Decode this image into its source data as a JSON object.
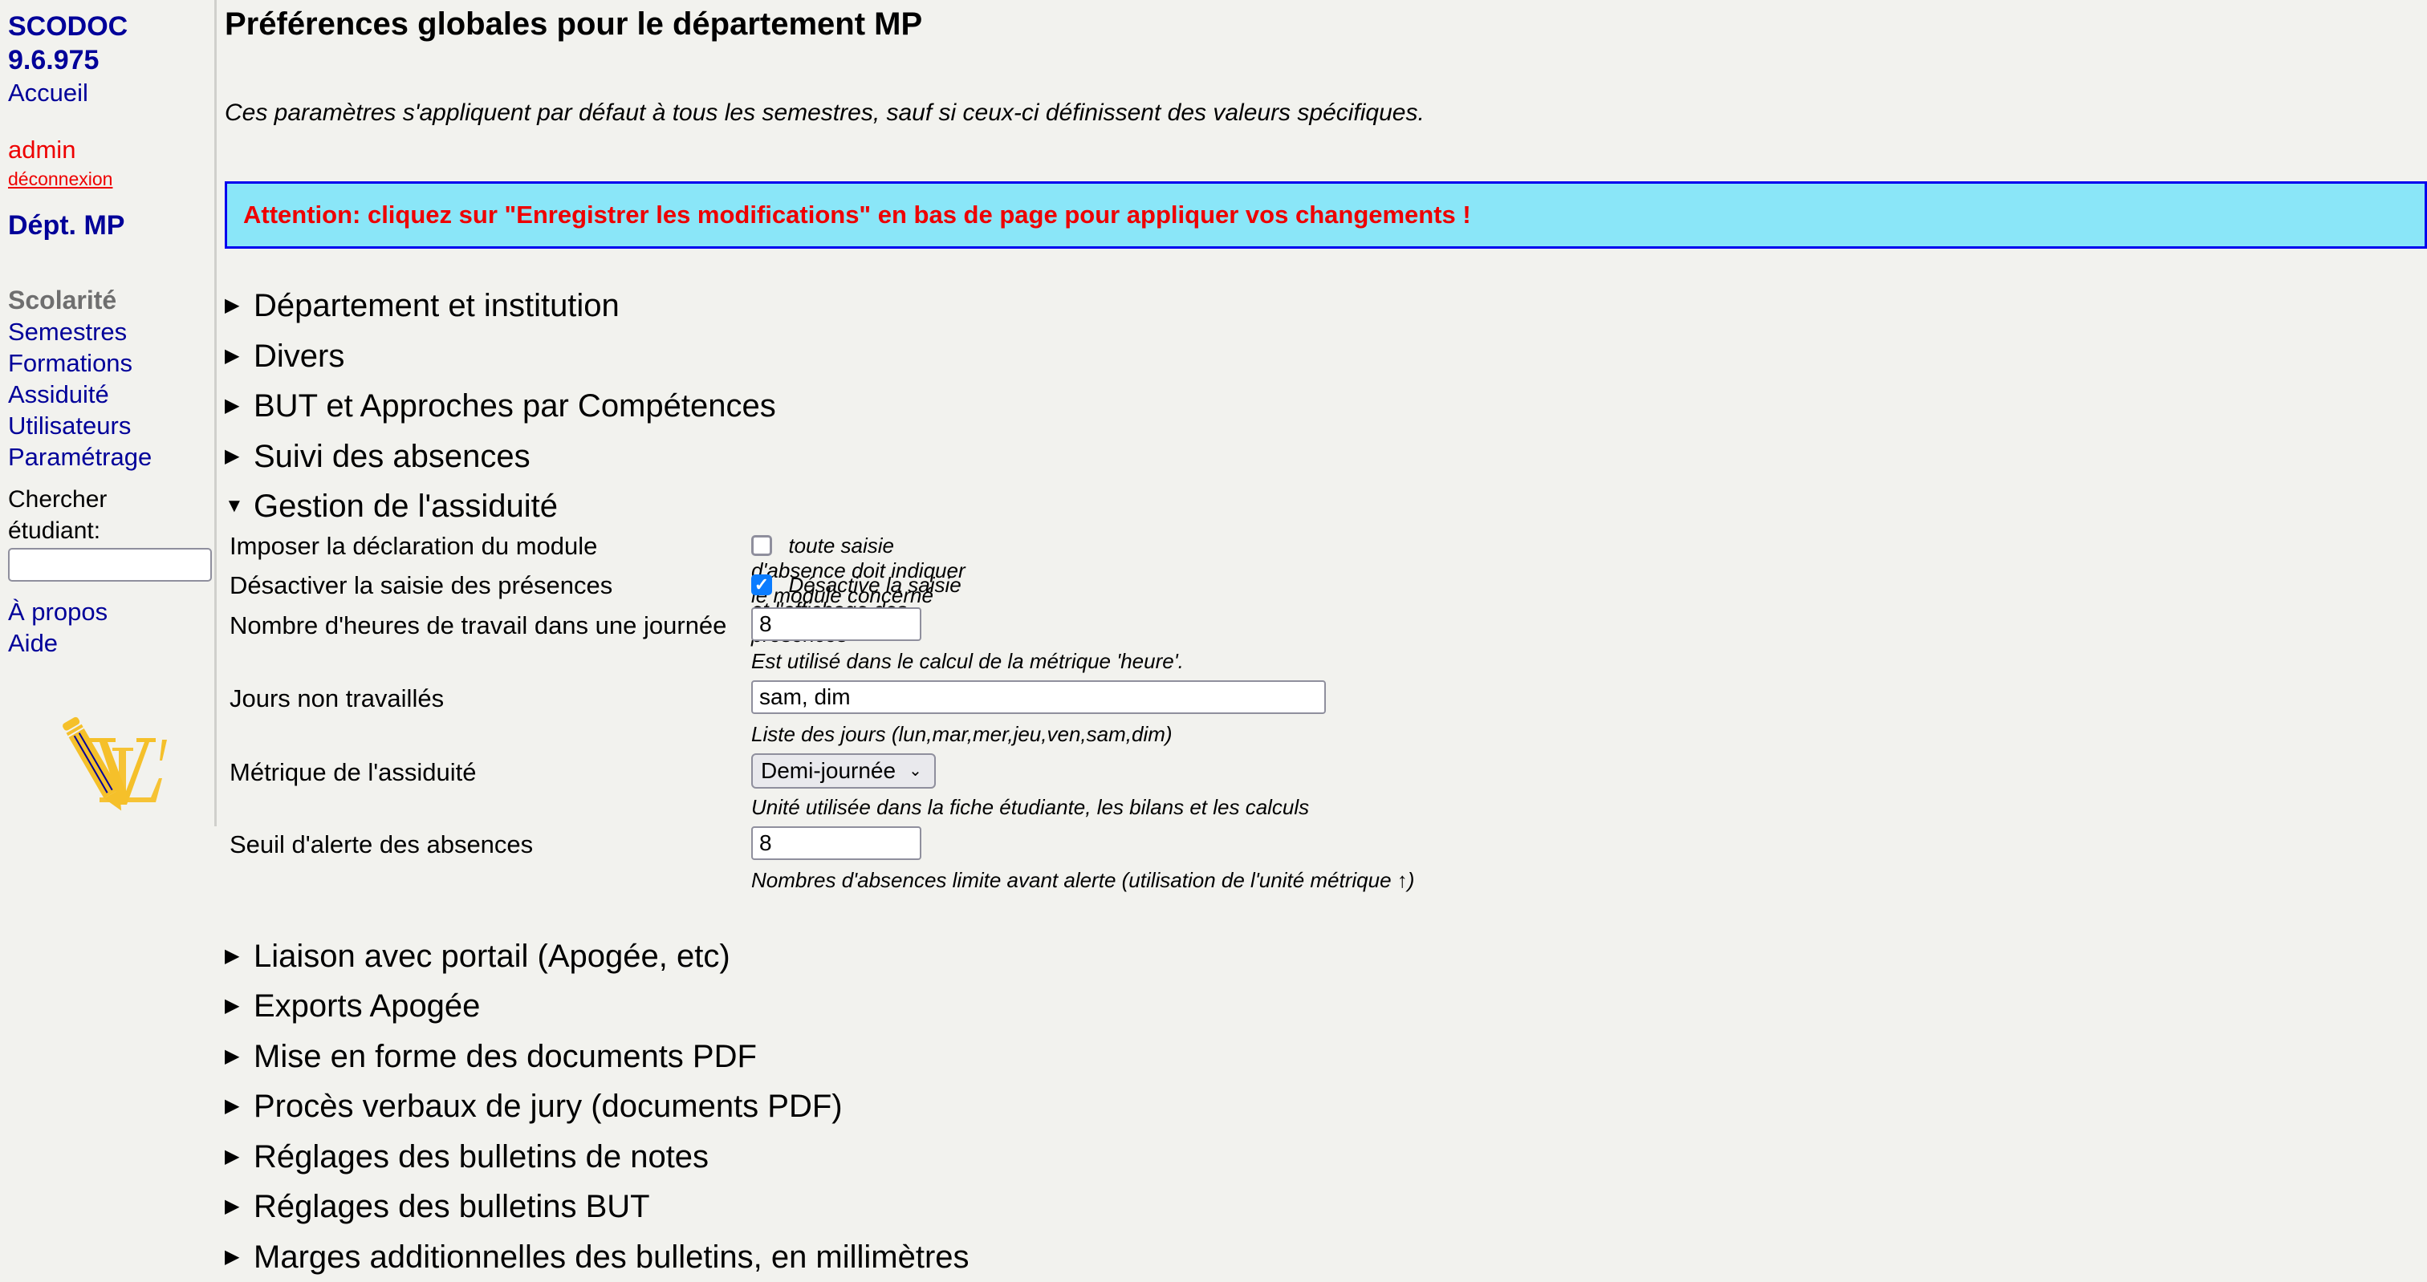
{
  "sidebar": {
    "brand_line1": "SCODOC",
    "brand_line2": "9.6.975",
    "home": "Accueil",
    "user": "admin",
    "logout": "déconnexion",
    "department": "Dépt. MP",
    "section_title": "Scolarité",
    "nav": [
      "Semestres",
      "Formations",
      "Assiduité",
      "Utilisateurs",
      "Paramétrage"
    ],
    "search_label_line1": "Chercher",
    "search_label_line2": "étudiant:",
    "search_value": "",
    "about": "À propos",
    "help": "Aide",
    "logo_icon": "pencil-logo-icon"
  },
  "main": {
    "title": "Préférences globales pour le département MP",
    "description": "Ces paramètres s'appliquent par défaut à tous les semestres, sauf si ceux-ci définissent des valeurs spécifiques.",
    "banner": "Attention: cliquez sur \"Enregistrer les modifications\" en bas de page pour appliquer vos changements !",
    "colors": {
      "banner_bg": "#8ae6f8",
      "banner_border": "#0000ee",
      "banner_text": "#ee0000",
      "link": "#000099",
      "checkbox_checked": "#0a7cff"
    },
    "sections_before": [
      {
        "label": "Département et institution",
        "expanded": false
      },
      {
        "label": "Divers",
        "expanded": false
      },
      {
        "label": "BUT et Approches par Compétences",
        "expanded": false
      },
      {
        "label": "Suivi des absences",
        "expanded": false
      }
    ],
    "open_section": {
      "label": "Gestion de l'assiduité",
      "expanded": true,
      "fields": {
        "module": {
          "label": "Imposer la déclaration du module",
          "checked": false,
          "text": "toute saisie d'absence doit indiquer le module concerné"
        },
        "presences": {
          "label": "Désactiver la saisie des présences",
          "checked": true,
          "text": "Désactive la saisie et l'affichage des présences"
        },
        "hours": {
          "label": "Nombre d'heures de travail dans une journée",
          "value": "8",
          "help": "Est utilisé dans le calcul de la métrique 'heure'."
        },
        "days_off": {
          "label": "Jours non travaillés",
          "value": "sam, dim",
          "help": "Liste des jours (lun,mar,mer,jeu,ven,sam,dim)"
        },
        "metric": {
          "label": "Métrique de l'assiduité",
          "selected": "Demi-journée",
          "help": "Unité utilisée dans la fiche étudiante, les bilans et les calculs"
        },
        "threshold": {
          "label": "Seuil d'alerte des absences",
          "value": "8",
          "help": "Nombres d'absences limite avant alerte (utilisation de l'unité métrique ↑)"
        }
      }
    },
    "sections_after": [
      {
        "label": "Liaison avec portail (Apogée, etc)",
        "expanded": false
      },
      {
        "label": "Exports Apogée",
        "expanded": false
      },
      {
        "label": "Mise en forme des documents PDF",
        "expanded": false
      },
      {
        "label": "Procès verbaux de jury (documents PDF)",
        "expanded": false
      },
      {
        "label": "Réglages des bulletins de notes",
        "expanded": false
      },
      {
        "label": "Réglages des bulletins BUT",
        "expanded": false
      },
      {
        "label": "Marges additionnelles des bulletins, en millimètres",
        "expanded": false
      }
    ],
    "glyphs": {
      "collapsed": "▶",
      "expanded": "▼",
      "check": "✓",
      "chevron": "⌄"
    }
  }
}
